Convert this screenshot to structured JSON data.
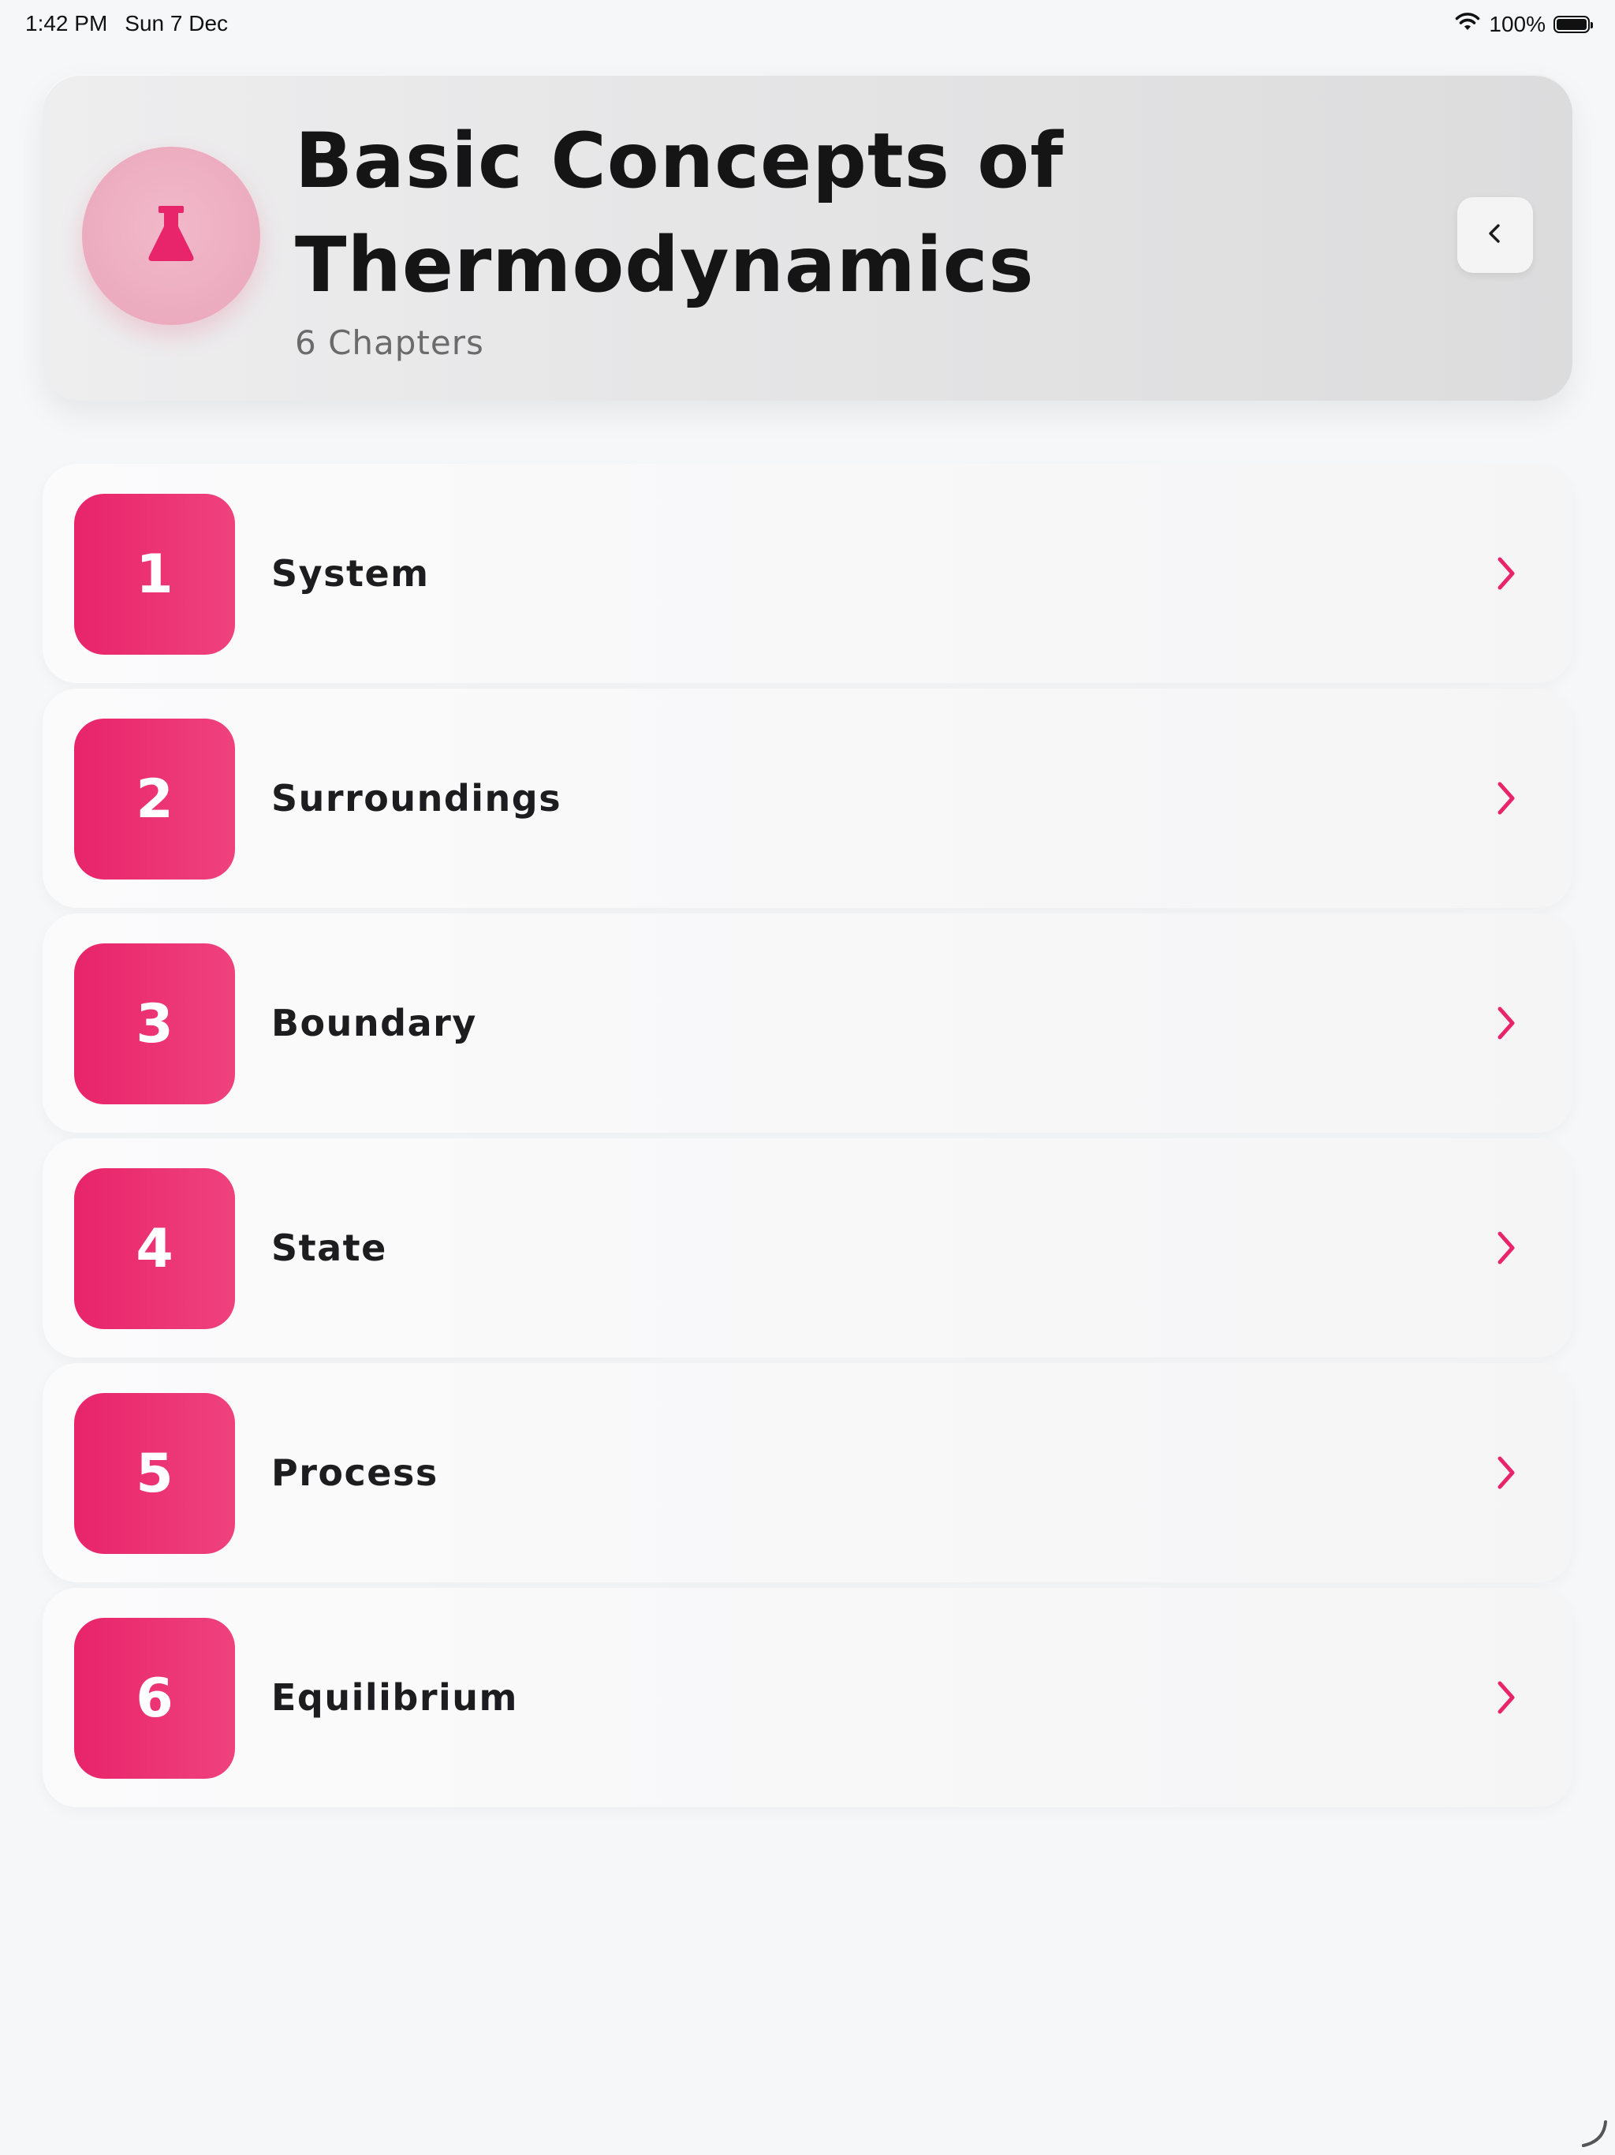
{
  "status_bar": {
    "time": "1:42 PM",
    "date": "Sun 7 Dec",
    "battery_percent": "100%",
    "battery_level": 1.0
  },
  "header": {
    "title": "Basic Concepts of Thermodynamics",
    "subtitle": "6 Chapters",
    "icon": "flask-icon",
    "back_icon": "chevron-left-icon"
  },
  "chapters": [
    {
      "number": "1",
      "title": "System"
    },
    {
      "number": "2",
      "title": "Surroundings"
    },
    {
      "number": "3",
      "title": "Boundary"
    },
    {
      "number": "4",
      "title": "State"
    },
    {
      "number": "5",
      "title": "Process"
    },
    {
      "number": "6",
      "title": "Equilibrium"
    }
  ],
  "colors": {
    "accent": "#e8246a",
    "accent_light": "#ef427d",
    "background": "#f6f7f9",
    "icon_circle": "#eeaabf"
  }
}
